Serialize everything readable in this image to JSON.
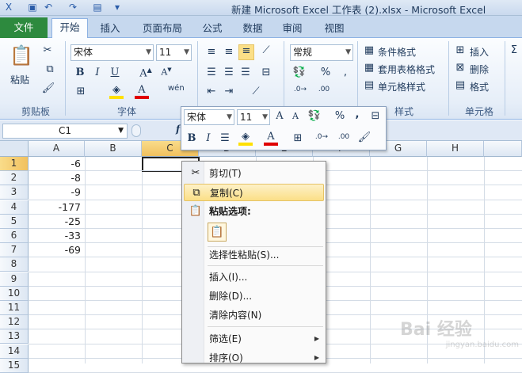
{
  "app": {
    "window_title": "新建 Microsoft Excel 工作表 (2).xlsx  -  Microsoft Excel"
  },
  "ribbon": {
    "tabs": [
      "文件",
      "开始",
      "插入",
      "页面布局",
      "公式",
      "数据",
      "审阅",
      "视图"
    ],
    "active_tab": "开始",
    "clipboard": {
      "paste_label": "粘贴",
      "group_label": "剪贴板"
    },
    "font": {
      "font_name": "宋体",
      "font_size": "11",
      "group_label": "字体"
    },
    "number": {
      "format": "常规"
    },
    "styles": {
      "conditional_format": "条件格式",
      "table_format": "套用表格格式",
      "cell_styles": "单元格样式",
      "group_label": "样式"
    },
    "cells": {
      "insert": "插入",
      "delete": "删除",
      "format": "格式",
      "group_label": "单元格"
    }
  },
  "formula_bar": {
    "name_box": "C1",
    "fx": "f"
  },
  "sheet": {
    "columns": [
      "A",
      "B",
      "C",
      "D",
      "E",
      "F",
      "G",
      "H"
    ],
    "selected_column": "C",
    "rows": [
      "1",
      "2",
      "3",
      "4",
      "5",
      "6",
      "7",
      "8",
      "9",
      "10",
      "11",
      "12",
      "13",
      "14",
      "15"
    ],
    "selected_row": "1",
    "column_a_values": [
      "-6",
      "-8",
      "-9",
      "-177",
      "-25",
      "-33",
      "-69"
    ]
  },
  "mini_toolbar": {
    "font_name": "宋体",
    "font_size": "11"
  },
  "context_menu": {
    "items": [
      {
        "label": "剪切(T)",
        "icon": "scissors-icon"
      },
      {
        "label": "复制(C)",
        "icon": "copy-icon",
        "highlighted": true
      },
      {
        "label": "粘贴选项:",
        "icon": "paste-icon",
        "bold": true
      },
      {
        "label": "选择性粘贴(S)..."
      },
      {
        "label": "插入(I)..."
      },
      {
        "label": "删除(D)..."
      },
      {
        "label": "清除内容(N)"
      },
      {
        "label": "筛选(E)",
        "submenu": true
      },
      {
        "label": "排序(O)",
        "submenu": true
      }
    ]
  },
  "watermark": {
    "text": "Bai 经验",
    "sub": "jingyan.baidu.com"
  },
  "colors": {
    "accent": "#2d8a3e",
    "ribbon_bg": "#dbe6f4",
    "highlight": "#fbdf87"
  }
}
